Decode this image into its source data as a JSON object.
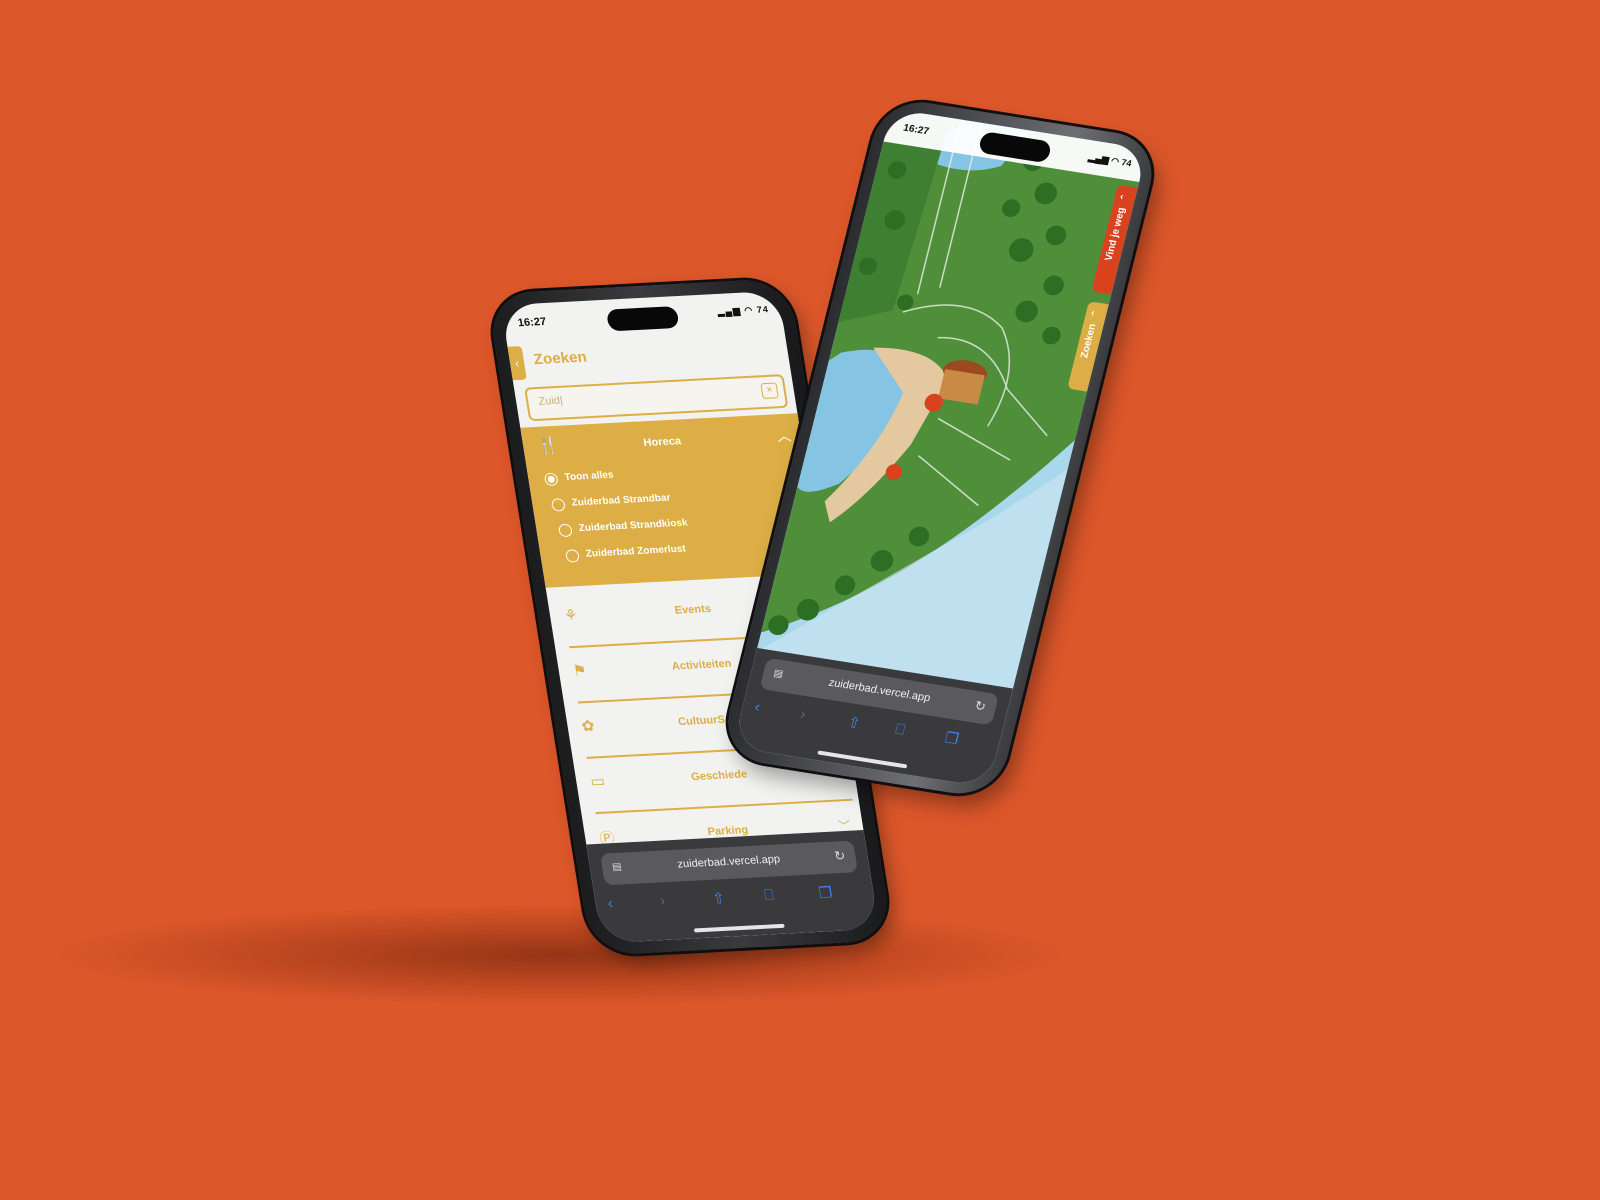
{
  "colors": {
    "background": "#dc572a",
    "accent_gold": "#dcae45",
    "accent_red": "#d8431e",
    "safari_blue": "#3b82f6"
  },
  "left_phone": {
    "status": {
      "time": "16:27",
      "icons": "▂▄▆ ◠ 74"
    },
    "header": {
      "back_icon": "chevron-left-icon",
      "title": "Zoeken"
    },
    "search": {
      "value": "Zuid|",
      "clear_icon": "close-icon"
    },
    "horeca": {
      "label": "Horeca",
      "icon": "fork-knife-icon",
      "expanded": true,
      "options": [
        {
          "label": "Toon alles",
          "selected": true
        },
        {
          "label": "Zuiderbad Strandbar",
          "selected": false
        },
        {
          "label": "Zuiderbad Strandkiosk",
          "selected": false
        },
        {
          "label": "Zuiderbad Zomerlust",
          "selected": false
        }
      ]
    },
    "categories": [
      {
        "label": "Events",
        "icon": "balloons-icon"
      },
      {
        "label": "Activiteiten",
        "icon": "checkered-flag-icon"
      },
      {
        "label": "CultuurSpor",
        "icon": "culture-icon"
      },
      {
        "label": "Geschiede",
        "icon": "book-icon"
      },
      {
        "label": "Parking",
        "icon": "parking-icon"
      }
    ],
    "browser": {
      "url": "zuiderbad.vercel.app"
    }
  },
  "right_phone": {
    "status": {
      "time": "16:27",
      "icons": "▂▄▆ ◠ 74"
    },
    "tabs": {
      "vind": "Vind je weg",
      "zoeken": "Zoeken"
    },
    "browser": {
      "url": "zuiderbad.vercel.app"
    }
  }
}
